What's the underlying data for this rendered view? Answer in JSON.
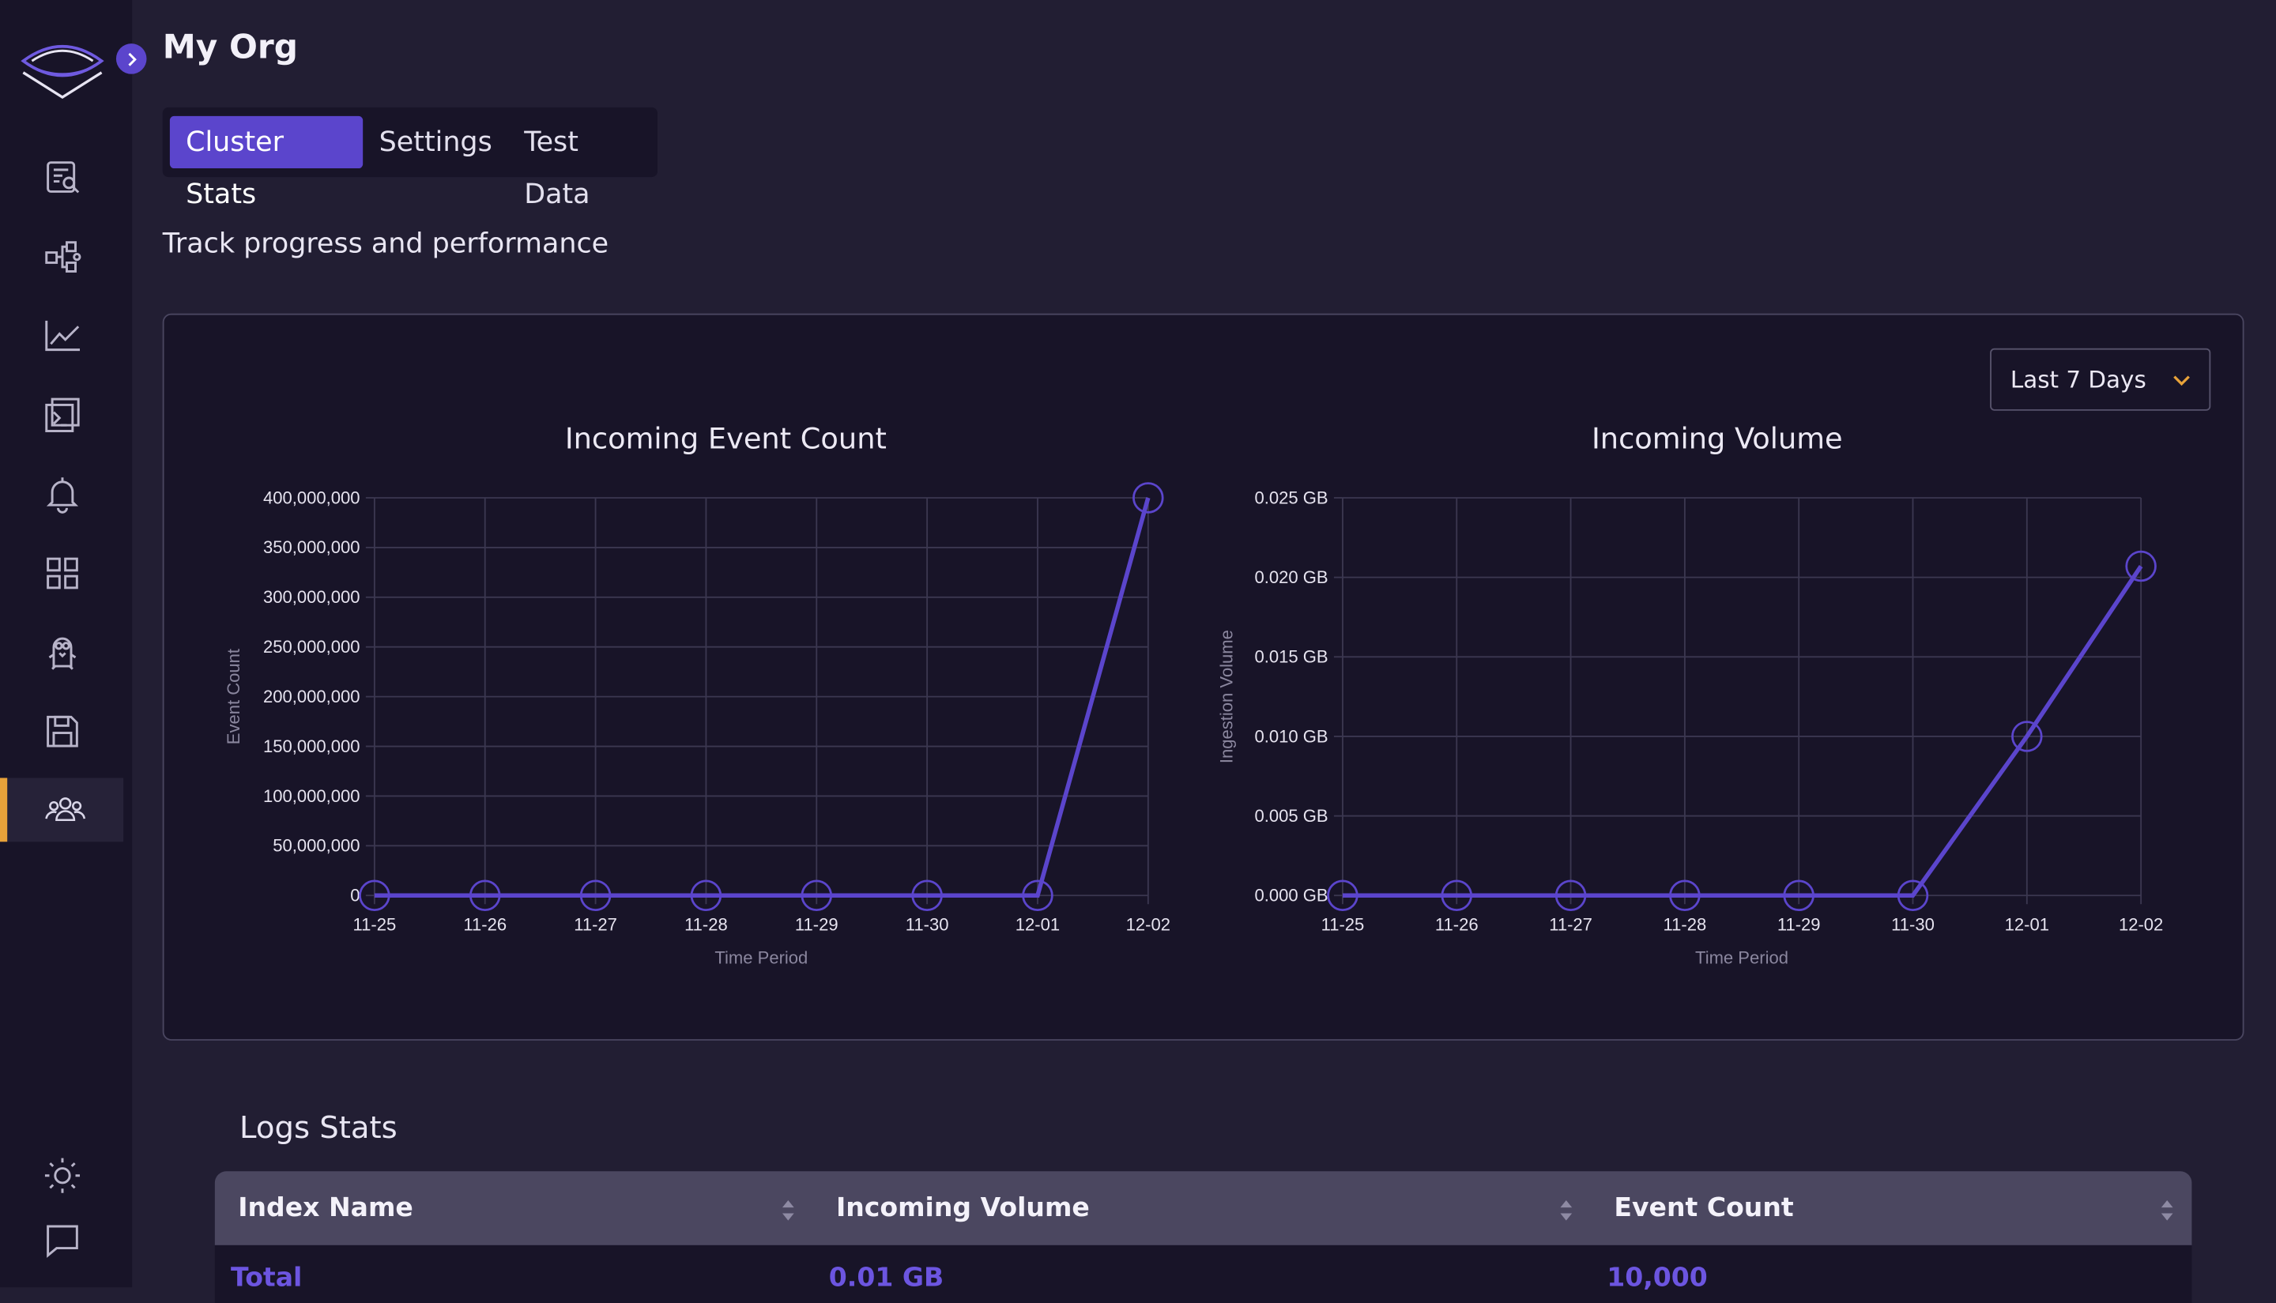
{
  "header": {
    "title": "My Org"
  },
  "tabs": [
    {
      "label": "Cluster Stats",
      "active": true
    },
    {
      "label": "Settings",
      "active": false
    },
    {
      "label": "Test Data",
      "active": false
    }
  ],
  "subtitle": "Track progress and performance",
  "range_select": {
    "value": "Last 7 Days"
  },
  "sidebar": {
    "items": [
      {
        "icon": "search-logs-icon"
      },
      {
        "icon": "pipeline-icon"
      },
      {
        "icon": "metrics-icon"
      },
      {
        "icon": "query-console-icon"
      },
      {
        "icon": "alerts-bell-icon"
      },
      {
        "icon": "dashboards-grid-icon"
      },
      {
        "icon": "penguin-icon"
      },
      {
        "icon": "save-icon"
      },
      {
        "icon": "team-icon",
        "active": true
      }
    ],
    "bottom": [
      {
        "icon": "theme-sun-icon"
      },
      {
        "icon": "feedback-chat-icon"
      }
    ]
  },
  "colors": {
    "accent": "#5b45cc",
    "active_marker": "#e8a23a",
    "line": "#5b45cc"
  },
  "chart_data": [
    {
      "type": "line",
      "title": "Incoming Event Count",
      "xlabel": "Time Period",
      "ylabel": "Event Count",
      "x": [
        "11-25",
        "11-26",
        "11-27",
        "11-28",
        "11-29",
        "11-30",
        "12-01",
        "12-02"
      ],
      "values": [
        0,
        0,
        0,
        0,
        0,
        0,
        0,
        400000000
      ],
      "ylim": [
        0,
        400000000
      ],
      "yticks": [
        "0",
        "50,000,000",
        "100,000,000",
        "150,000,000",
        "200,000,000",
        "250,000,000",
        "300,000,000",
        "350,000,000",
        "400,000,000"
      ],
      "grid": true
    },
    {
      "type": "line",
      "title": "Incoming Volume",
      "xlabel": "Time Period",
      "ylabel": "Ingestion Volume",
      "x": [
        "11-25",
        "11-26",
        "11-27",
        "11-28",
        "11-29",
        "11-30",
        "12-01",
        "12-02"
      ],
      "values": [
        0,
        0,
        0,
        0,
        0,
        0,
        0.01,
        0.0207
      ],
      "ylim": [
        0,
        0.025
      ],
      "yticks": [
        "0.000 GB",
        "0.005 GB",
        "0.010 GB",
        "0.015 GB",
        "0.020 GB",
        "0.025 GB"
      ],
      "grid": true
    }
  ],
  "logs_stats": {
    "title": "Logs Stats",
    "columns": [
      "Index Name",
      "Incoming Volume",
      "Event Count"
    ],
    "rows": [
      [
        "Total",
        "0.01 GB",
        "10,000"
      ]
    ]
  }
}
